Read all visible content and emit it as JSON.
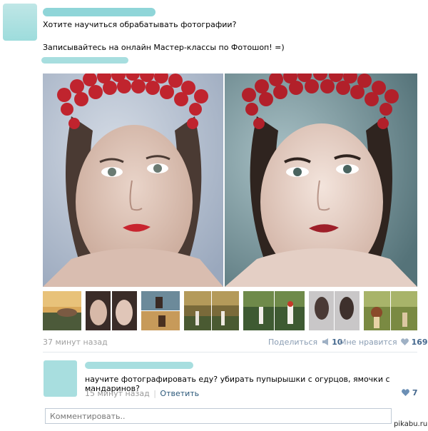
{
  "post": {
    "line1": "Хотите научиться обрабатывать фотографии?",
    "line2": "Записывайтесь на онлайн Мастер-классы по Фотошоп! =)"
  },
  "footer": {
    "time": "37 минут назад",
    "share_label": "Поделиться",
    "share_count": "10",
    "like_label": "Мне нравится",
    "like_count": "169",
    "share_icon": "megaphone-icon",
    "like_icon": "heart-icon"
  },
  "comment": {
    "text": "научите фотографировать еду? убирать пупырышки с огурцов, ямочки с мандаринов?",
    "time": "15 минут назад",
    "separator": "|",
    "reply_label": "Ответить",
    "likes": "7"
  },
  "input": {
    "placeholder": "Комментировать.."
  },
  "watermark": "pikabu.ru",
  "colors": {
    "link": "#45688e",
    "muted": "#a0a0a0",
    "blur": "#8fd5d8"
  }
}
